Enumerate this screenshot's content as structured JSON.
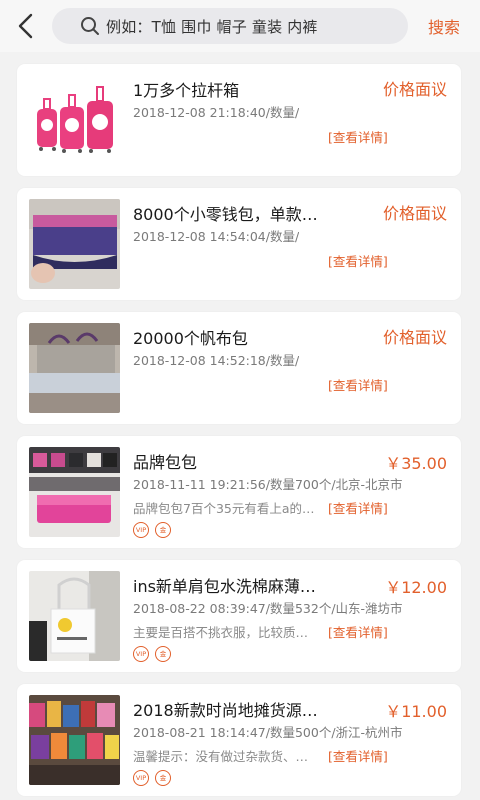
{
  "search": {
    "placeholder": "例如：T恤  围巾  帽子  童装  内裤",
    "button": "搜索"
  },
  "detail_label": "[查看详情]",
  "badges": {
    "vip": "VIP",
    "credit": "金"
  },
  "items": [
    {
      "title": "1万多个拉杆箱",
      "price": "价格面议",
      "meta": "2018-12-08 21:18:40/数量/",
      "desc": ""
    },
    {
      "title": "8000个小零钱包，单款…",
      "price": "价格面议",
      "meta": "2018-12-08 14:54:04/数量/",
      "desc": ""
    },
    {
      "title": "20000个帆布包",
      "price": "价格面议",
      "meta": "2018-12-08 14:52:18/数量/",
      "desc": ""
    },
    {
      "title": "品牌包包",
      "price": "￥35.00",
      "meta": "2018-11-11 19:21:56/数量700个/北京-北京市",
      "desc": "品牌包包7百个35元有看上a的…"
    },
    {
      "title": "ins新单肩包水洗棉麻薄…",
      "price": "￥12.00",
      "meta": "2018-08-22 08:39:47/数量532个/山东-潍坊市",
      "desc": "主要是百搭不挑衣服，比较质…"
    },
    {
      "title": "2018新款时尚地摊货源…",
      "price": "￥11.00",
      "meta": "2018-08-21 18:14:47/数量500个/浙江-杭州市",
      "desc": "温馨提示：没有做过杂款货、…"
    }
  ],
  "colors": {
    "accent": "#e2602c",
    "background": "#f2f2f2"
  }
}
